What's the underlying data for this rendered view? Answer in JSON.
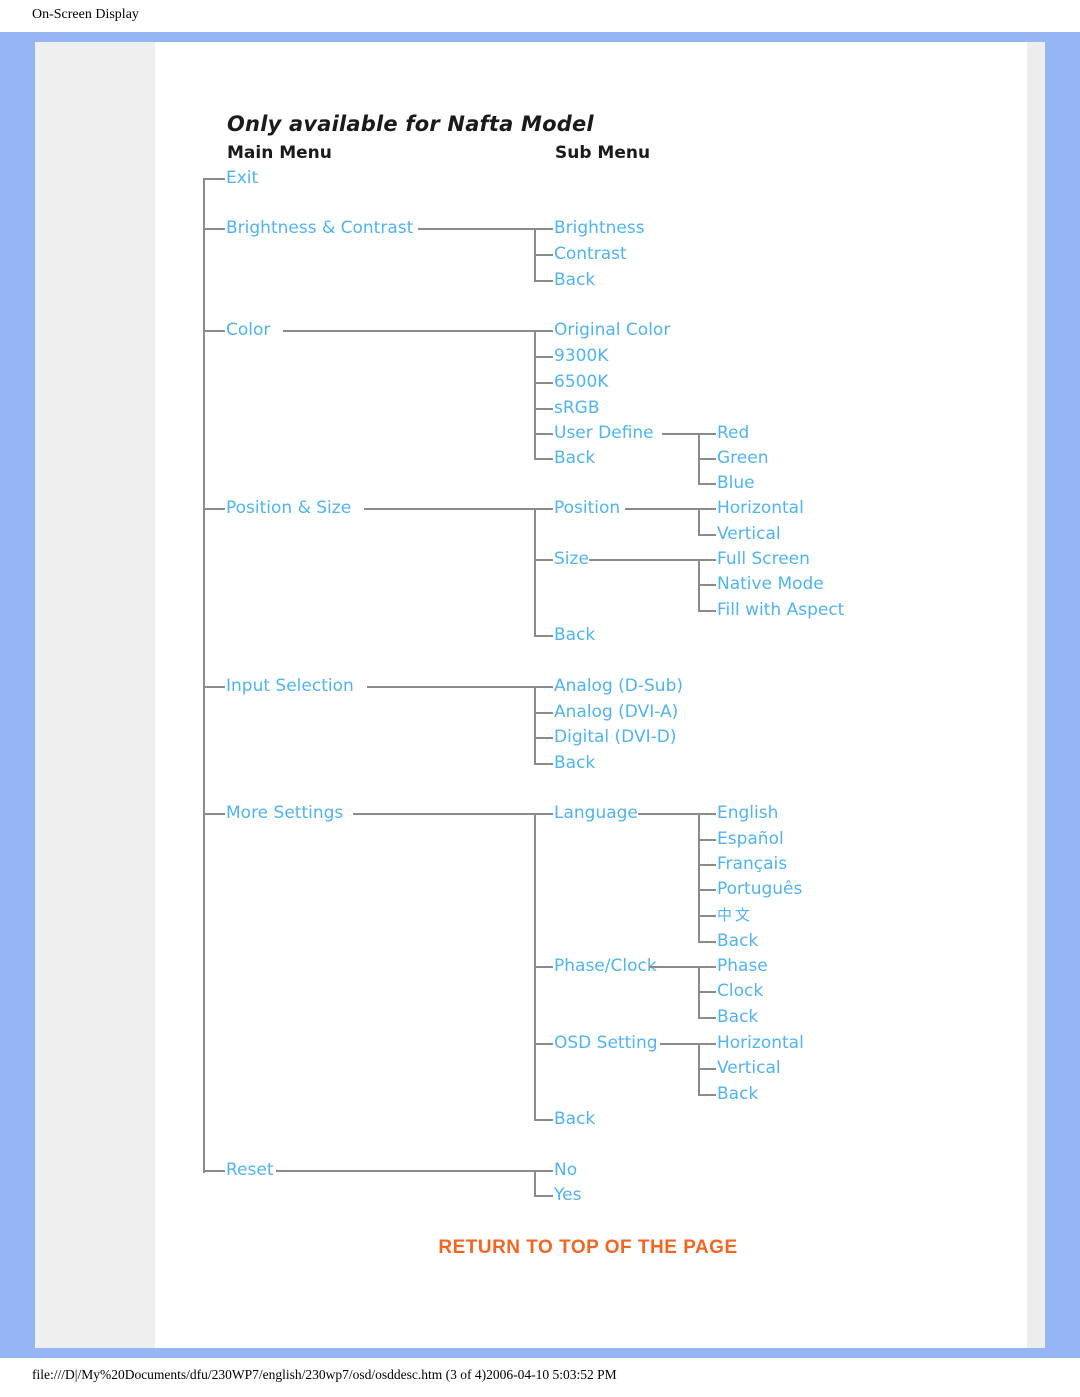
{
  "header": {
    "title": "On-Screen Display"
  },
  "diagram": {
    "note": "Only available for Nafta Model",
    "col_main": "Main Menu",
    "col_sub": "Sub Menu",
    "accent_text": "#4fb4ef",
    "accent_frame": "#96b5f5",
    "accent_link": "#f26522",
    "nodes": {
      "exit": "Exit",
      "brightness_contrast": "Brightness & Contrast",
      "brightness": "Brightness",
      "contrast": "Contrast",
      "bc_back": "Back",
      "color": "Color",
      "original_color": "Original Color",
      "k9300": "9300K",
      "k6500": "6500K",
      "srgb": "sRGB",
      "user_define": "User Define",
      "color_back": "Back",
      "red": "Red",
      "green": "Green",
      "blue": "Blue",
      "position_size": "Position & Size",
      "position": "Position",
      "horizontal_pos": "Horizontal",
      "vertical_pos": "Vertical",
      "size": "Size",
      "full_screen": "Full Screen",
      "native_mode": "Native Mode",
      "fill_with_aspect": "Fill with Aspect",
      "ps_back": "Back",
      "input_selection": "Input Selection",
      "analog_dsub": "Analog (D-Sub)",
      "analog_dvia": "Analog (DVI-A)",
      "digital_dvid": "Digital (DVI-D)",
      "input_back": "Back",
      "more_settings": "More Settings",
      "language": "Language",
      "lang_english": "English",
      "lang_espanol": "Español",
      "lang_francais": "Français",
      "lang_portugues": "Português",
      "lang_chinese": "中文",
      "lang_back": "Back",
      "phase_clock": "Phase/Clock",
      "phase": "Phase",
      "clock": "Clock",
      "pc_back": "Back",
      "osd_setting": "OSD Setting",
      "osd_horizontal": "Horizontal",
      "osd_vertical": "Vertical",
      "osd_back": "Back",
      "ms_back": "Back",
      "reset": "Reset",
      "reset_no": "No",
      "reset_yes": "Yes"
    }
  },
  "return_link": {
    "label": "RETURN TO TOP OF THE PAGE"
  },
  "footer": {
    "path": "file:///D|/My%20Documents/dfu/230WP7/english/230wp7/osd/osddesc.htm (3 of 4)2006-04-10 5:03:52 PM"
  }
}
